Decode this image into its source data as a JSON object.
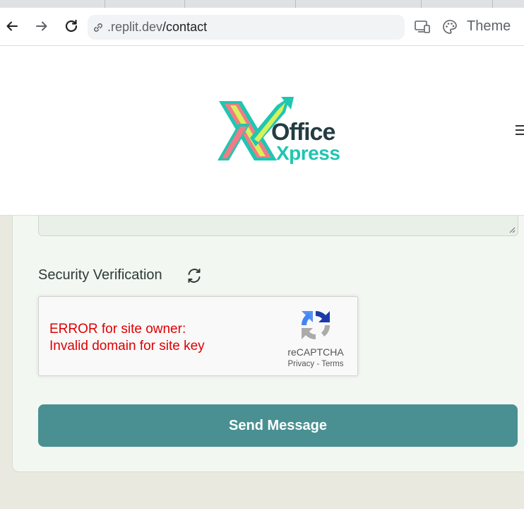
{
  "browser": {
    "url_host": ".replit.dev",
    "url_path": "/contact",
    "theme_label": "Theme",
    "icons": {
      "back": "arrow-left-icon",
      "forward": "arrow-right-icon",
      "reload": "reload-icon",
      "site_info": "link-icon",
      "devices": "devices-icon",
      "palette": "palette-icon"
    }
  },
  "header": {
    "logo_word1": "Office",
    "logo_word2": "Xpress",
    "menu_icon": "hamburger-icon"
  },
  "form": {
    "security_label": "Security Verification",
    "refresh_icon": "refresh-icon",
    "recaptcha": {
      "error_line1": "ERROR for site owner:",
      "error_line2": "Invalid domain for site key",
      "brand": "reCAPTCHA",
      "privacy": "Privacy",
      "separator": " - ",
      "terms": "Terms"
    },
    "submit_label": "Send Message"
  },
  "colors": {
    "button_bg": "#4a9093",
    "error_text": "#e00000",
    "logo_teal": "#1fc6b1",
    "logo_dark": "#243c42"
  }
}
